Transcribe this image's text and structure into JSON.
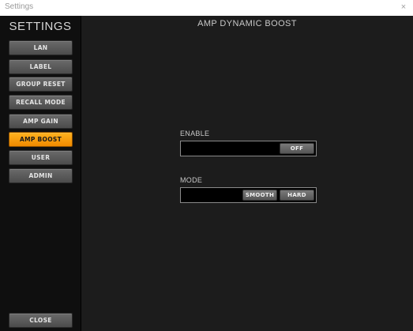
{
  "window": {
    "title": "Settings",
    "close_glyph": "×"
  },
  "sidebar": {
    "heading": "SETTINGS",
    "items": [
      {
        "label": "LAN",
        "active": false
      },
      {
        "label": "LABEL",
        "active": false
      },
      {
        "label": "GROUP RESET",
        "active": false
      },
      {
        "label": "RECALL MODE",
        "active": false
      },
      {
        "label": "AMP GAIN",
        "active": false
      },
      {
        "label": "AMP BOOST",
        "active": true
      },
      {
        "label": "USER",
        "active": false
      },
      {
        "label": "ADMIN",
        "active": false
      }
    ],
    "close_label": "CLOSE"
  },
  "main": {
    "title": "AMP DYNAMIC BOOST",
    "enable": {
      "label": "ENABLE",
      "button_label": "OFF"
    },
    "mode": {
      "label": "MODE",
      "options": [
        "SMOOTH",
        "HARD"
      ]
    }
  },
  "colors": {
    "accent": "#f59a0a",
    "background": "#1c1c1c",
    "sidebar_background": "#0f0f0f",
    "button_gray": "#5b5b5b"
  }
}
